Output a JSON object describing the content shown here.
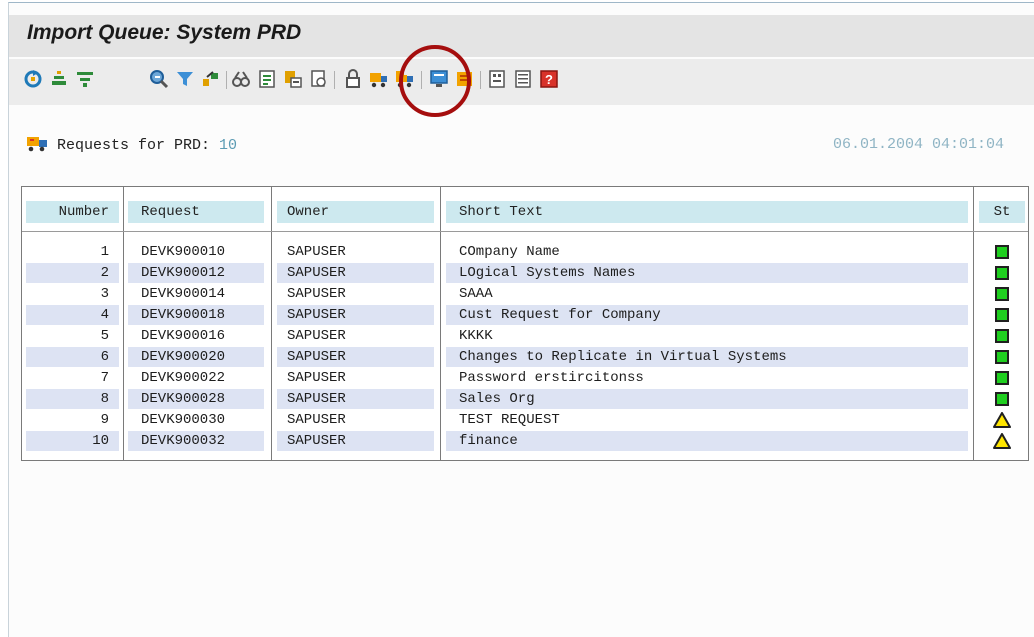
{
  "window": {
    "title": "Import Queue: System PRD"
  },
  "toolbar": {
    "icons": [
      "refresh-icon",
      "import-all-icon",
      "filter-requests-icon",
      "display-icon",
      "filter-icon",
      "import-monitor-icon",
      "glasses-icon",
      "document-icon",
      "request-detail-icon",
      "log-icon",
      "lock-icon",
      "import-request-icon",
      "import-all-requests-icon",
      "monitor-icon",
      "tools-icon",
      "overview-icon",
      "list-icon",
      "help-icon"
    ]
  },
  "summary": {
    "label": "Requests for PRD:",
    "count": "10",
    "timestamp": "06.01.2004 04:01:04"
  },
  "table": {
    "headers": {
      "number": "Number",
      "request": "Request",
      "owner": "Owner",
      "short_text": "Short Text",
      "status": "St"
    },
    "rows": [
      {
        "number": "1",
        "request": "DEVK900010",
        "owner": "SAPUSER",
        "short_text": "COmpany Name",
        "status": "green"
      },
      {
        "number": "2",
        "request": "DEVK900012",
        "owner": "SAPUSER",
        "short_text": "LOgical Systems Names",
        "status": "green"
      },
      {
        "number": "3",
        "request": "DEVK900014",
        "owner": "SAPUSER",
        "short_text": "SAAA",
        "status": "green"
      },
      {
        "number": "4",
        "request": "DEVK900018",
        "owner": "SAPUSER",
        "short_text": "Cust Request for Company",
        "status": "green"
      },
      {
        "number": "5",
        "request": "DEVK900016",
        "owner": "SAPUSER",
        "short_text": "KKKK",
        "status": "green"
      },
      {
        "number": "6",
        "request": "DEVK900020",
        "owner": "SAPUSER",
        "short_text": "Changes to Replicate in Virtual Systems",
        "status": "green"
      },
      {
        "number": "7",
        "request": "DEVK900022",
        "owner": "SAPUSER",
        "short_text": "Password erstircitonss",
        "status": "green"
      },
      {
        "number": "8",
        "request": "DEVK900028",
        "owner": "SAPUSER",
        "short_text": "Sales Org",
        "status": "green"
      },
      {
        "number": "9",
        "request": "DEVK900030",
        "owner": "SAPUSER",
        "short_text": "TEST REQUEST",
        "status": "warning"
      },
      {
        "number": "10",
        "request": "DEVK900032",
        "owner": "SAPUSER",
        "short_text": "finance",
        "status": "warning"
      }
    ]
  },
  "colors": {
    "status_green": "#1fcf1f",
    "status_warning": "#ffe600",
    "annotation": "#a50e0e",
    "header_bg": "#cde9ef",
    "alt_row": "#dde3f3"
  }
}
